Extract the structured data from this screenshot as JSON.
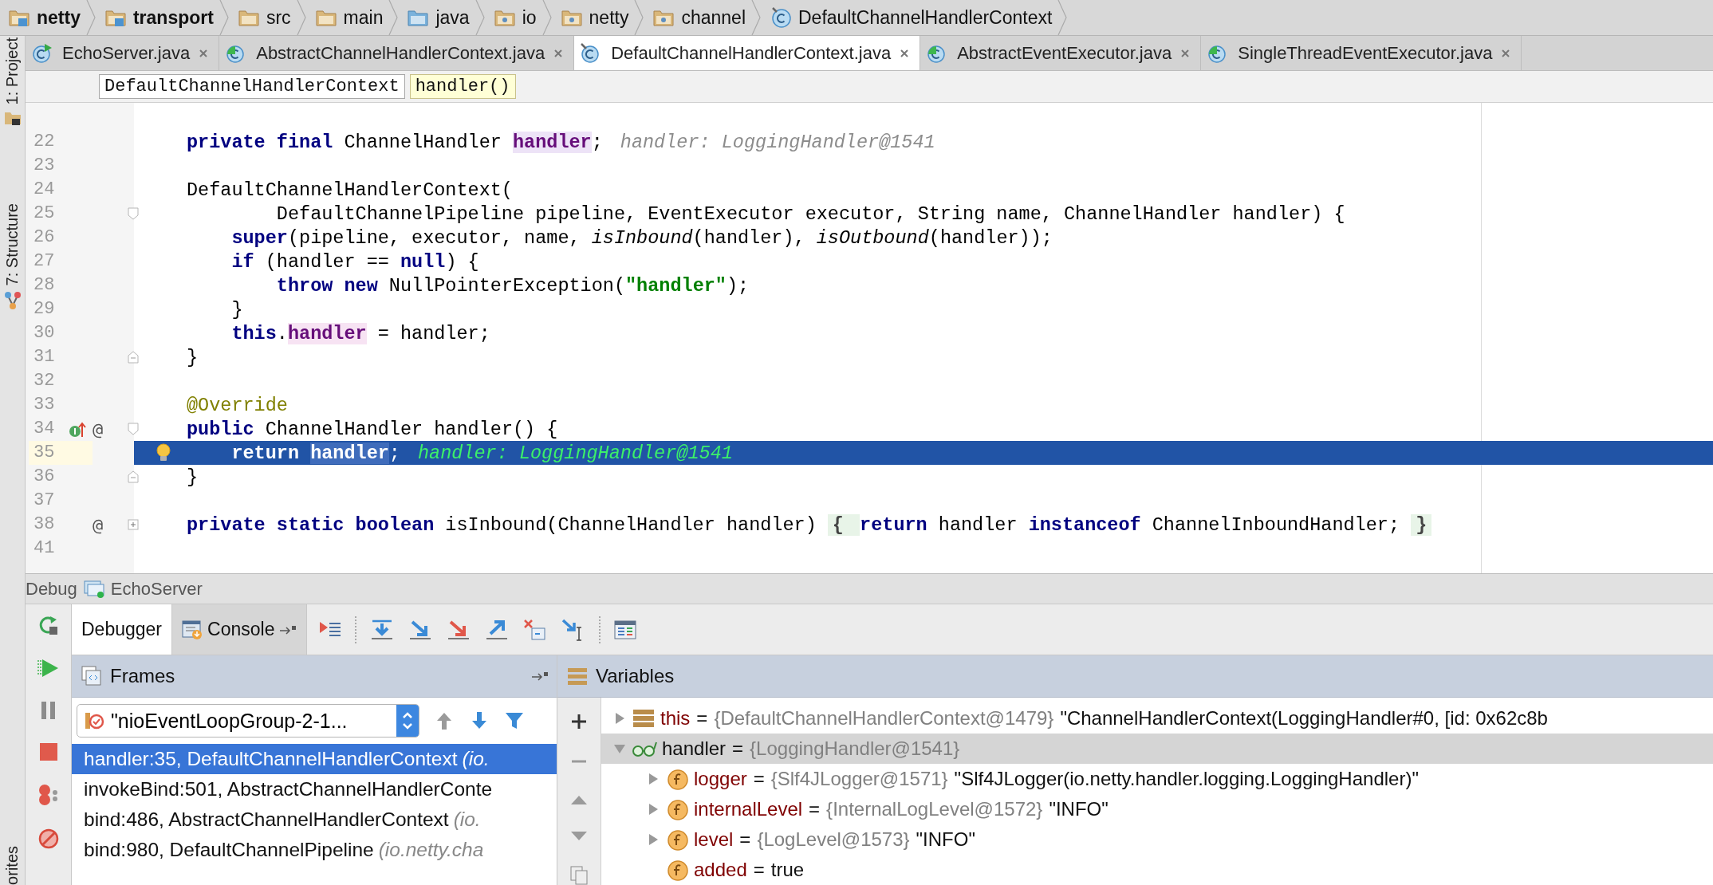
{
  "breadcrumbs": [
    {
      "label": "netty",
      "kind": "module"
    },
    {
      "label": "transport",
      "kind": "module"
    },
    {
      "label": "src",
      "kind": "folder"
    },
    {
      "label": "main",
      "kind": "folder"
    },
    {
      "label": "java",
      "kind": "source"
    },
    {
      "label": "io",
      "kind": "package"
    },
    {
      "label": "netty",
      "kind": "package"
    },
    {
      "label": "channel",
      "kind": "package"
    },
    {
      "label": "DefaultChannelHandlerContext",
      "kind": "class"
    }
  ],
  "side_tools": [
    {
      "label": "1: Project",
      "kind": "project"
    },
    {
      "label": "7: Structure",
      "kind": "structure"
    },
    {
      "label": "orites",
      "kind": "favorites"
    }
  ],
  "editor_tabs": [
    {
      "label": "EchoServer.java",
      "kind": "runnable",
      "selected": false
    },
    {
      "label": "AbstractChannelHandlerContext.java",
      "kind": "abstract",
      "selected": false
    },
    {
      "label": "DefaultChannelHandlerContext.java",
      "kind": "pinned",
      "selected": true
    },
    {
      "label": "AbstractEventExecutor.java",
      "kind": "abstract",
      "selected": false
    },
    {
      "label": "SingleThreadEventExecutor.java",
      "kind": "abstract",
      "selected": false
    }
  ],
  "nav_path": [
    {
      "label": "DefaultChannelHandlerContext",
      "selected": false
    },
    {
      "label": "handler()",
      "selected": true
    }
  ],
  "editor": {
    "lines": [
      {
        "number": "22",
        "current": false,
        "tokens": [
          {
            "text": "private final",
            "kind": "keyword"
          },
          {
            "text": " ChannelHandler ",
            "kind": "plain"
          },
          {
            "text": "handler",
            "kind": "field_decl"
          },
          {
            "text": ";",
            "kind": "plain"
          }
        ],
        "hint": {
          "text": "handler: LoggingHandler@1541",
          "kind": "value"
        }
      },
      {
        "number": "23",
        "current": false
      },
      {
        "number": "24",
        "current": false,
        "tokens": [
          {
            "text": "DefaultChannelHandlerContext(",
            "kind": "plain"
          }
        ]
      },
      {
        "number": "25",
        "current": false,
        "gutter_icons": [
          {
            "kind": "fold_start"
          }
        ],
        "tokens": [
          {
            "text": "        DefaultChannelPipeline pipeline, EventExecutor executor, String name, ChannelHandler handler) {",
            "kind": "plain"
          }
        ]
      },
      {
        "number": "26",
        "current": false,
        "tokens": [
          {
            "text": "    super",
            "kind": "keyword"
          },
          {
            "text": "(pipeline, executor, name, ",
            "kind": "plain"
          },
          {
            "text": "isInbound",
            "kind": "italic"
          },
          {
            "text": "(handler), ",
            "kind": "plain"
          },
          {
            "text": "isOutbound",
            "kind": "italic"
          },
          {
            "text": "(handler));",
            "kind": "plain"
          }
        ]
      },
      {
        "number": "27",
        "current": false,
        "tokens": [
          {
            "text": "    if",
            "kind": "keyword"
          },
          {
            "text": " (handler == ",
            "kind": "plain"
          },
          {
            "text": "null",
            "kind": "keyword"
          },
          {
            "text": ") {",
            "kind": "plain"
          }
        ]
      },
      {
        "number": "28",
        "current": false,
        "tokens": [
          {
            "text": "        throw new",
            "kind": "keyword"
          },
          {
            "text": " NullPointerException(",
            "kind": "plain"
          },
          {
            "text": "\"handler\"",
            "kind": "string"
          },
          {
            "text": ");",
            "kind": "plain"
          }
        ]
      },
      {
        "number": "29",
        "current": false,
        "tokens": [
          {
            "text": "    }",
            "kind": "plain"
          }
        ]
      },
      {
        "number": "30",
        "current": false,
        "tokens": [
          {
            "text": "    this",
            "kind": "keyword"
          },
          {
            "text": ".",
            "kind": "plain"
          },
          {
            "text": "handler",
            "kind": "field_use"
          },
          {
            "text": " = handler;",
            "kind": "plain"
          }
        ]
      },
      {
        "number": "31",
        "current": false,
        "gutter_icons": [
          {
            "kind": "fold_end"
          }
        ],
        "tokens": [
          {
            "text": "}",
            "kind": "plain"
          }
        ]
      },
      {
        "number": "32",
        "current": false
      },
      {
        "number": "33",
        "current": false,
        "tokens": [
          {
            "text": "@Override",
            "kind": "annotation"
          }
        ]
      },
      {
        "number": "34",
        "current": false,
        "gutter_icons": [
          {
            "kind": "implements"
          },
          {
            "kind": "fold_start"
          }
        ],
        "gutter_text": "@",
        "tokens": [
          {
            "text": "public",
            "kind": "keyword"
          },
          {
            "text": " ChannelHandler handler() {",
            "kind": "plain"
          }
        ]
      },
      {
        "number": "35",
        "current": true,
        "gutter_icons": [
          {
            "kind": "bulb"
          }
        ],
        "tokens": [
          {
            "text": "    return ",
            "kind": "keyword"
          },
          {
            "text": "handler",
            "kind": "field_use"
          },
          {
            "text": ";",
            "kind": "plain"
          }
        ],
        "hint": {
          "text": "handler: LoggingHandler@1541",
          "kind": "current"
        }
      },
      {
        "number": "36",
        "current": false,
        "gutter_icons": [
          {
            "kind": "fold_end"
          }
        ],
        "tokens": [
          {
            "text": "}",
            "kind": "plain"
          }
        ]
      },
      {
        "number": "37",
        "current": false
      },
      {
        "number": "38",
        "current": false,
        "gutter_icons": [
          {
            "kind": "fold_collapsed"
          }
        ],
        "gutter_text": "@",
        "tokens": [
          {
            "text": "private static boolean",
            "kind": "keyword"
          },
          {
            "text": " isInbound(ChannelHandler handler) ",
            "kind": "plain"
          },
          {
            "text": "{ ",
            "kind": "folded"
          },
          {
            "text": "return",
            "kind": "keyword"
          },
          {
            "text": " handler ",
            "kind": "plain"
          },
          {
            "text": "instanceof",
            "kind": "keyword"
          },
          {
            "text": " ChannelInboundHandler; ",
            "kind": "plain"
          },
          {
            "text": "}",
            "kind": "folded"
          }
        ]
      },
      {
        "number": "41",
        "current": false
      }
    ]
  },
  "debug": {
    "title": "Debug",
    "config": "EchoServer",
    "tabs": [
      {
        "label": "Debugger",
        "selected": true
      },
      {
        "label": "Console",
        "selected": false
      }
    ],
    "frames_title": "Frames",
    "thread": "\"nioEventLoopGroup-2-1...",
    "frames": [
      {
        "method": "handler:35, DefaultChannelHandlerContext",
        "package": "(io.",
        "selected": true
      },
      {
        "method": "invokeBind:501, AbstractChannelHandlerConte",
        "selected": false
      },
      {
        "method": "bind:486, AbstractChannelHandlerContext",
        "package": "(io.",
        "selected": false
      },
      {
        "method": "bind:980, DefaultChannelPipeline",
        "package": "(io.netty.cha",
        "selected": false
      }
    ],
    "variables_title": "Variables",
    "variables": [
      {
        "name": "this",
        "kind": "object",
        "operator": "=",
        "type": "{DefaultChannelHandlerContext@1479}",
        "value": "\"ChannelHandlerContext(LoggingHandler#0, [id: 0x62c8b",
        "expanded": false,
        "selected": false
      },
      {
        "name": "handler",
        "kind": "watch",
        "operator": "=",
        "type": "{LoggingHandler@1541}",
        "expanded": true,
        "selected": true,
        "children": [
          {
            "name": "logger",
            "kind": "field",
            "operator": "=",
            "type": "{Slf4JLogger@1571}",
            "value": "\"Slf4JLogger(io.netty.handler.logging.LoggingHandler)\"",
            "expanded": false,
            "selected": false
          },
          {
            "name": "internalLevel",
            "kind": "field",
            "operator": "=",
            "type": "{InternalLogLevel@1572}",
            "value": "\"INFO\"",
            "expanded": false,
            "selected": false
          },
          {
            "name": "level",
            "kind": "field",
            "operator": "=",
            "type": "{LogLevel@1573}",
            "value": "\"INFO\"",
            "expanded": false,
            "selected": false
          },
          {
            "name": "added",
            "kind": "field",
            "operator": "=",
            "value": "true",
            "selected": false
          }
        ]
      }
    ]
  }
}
